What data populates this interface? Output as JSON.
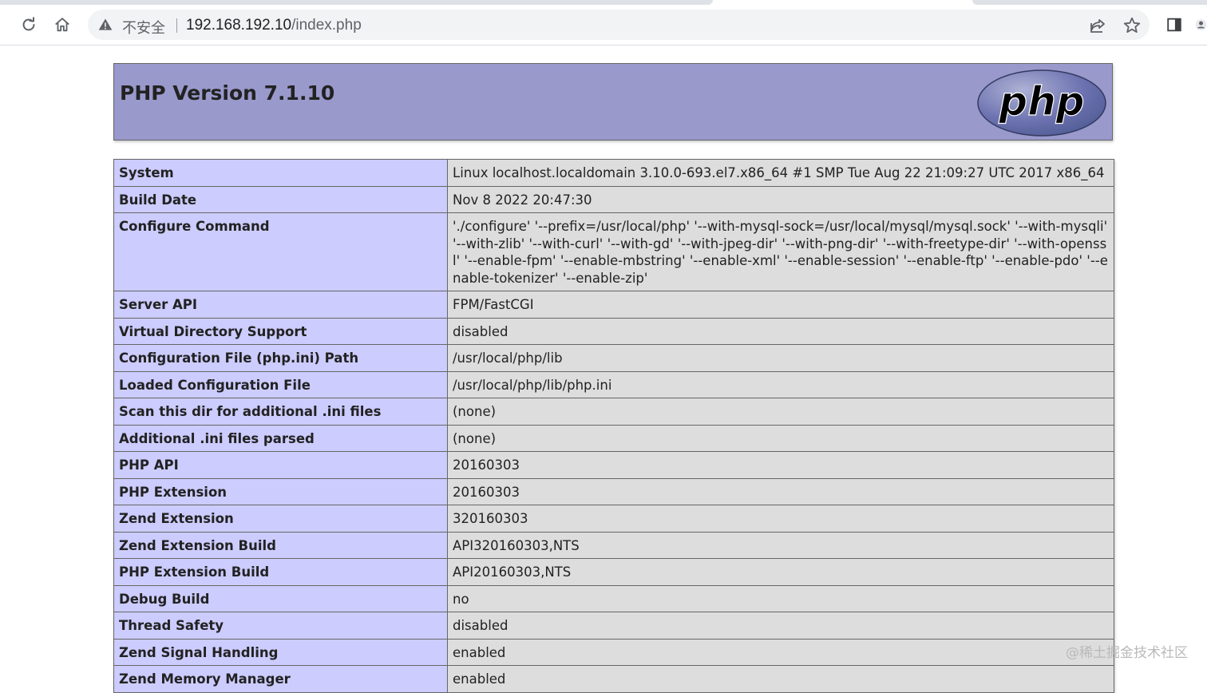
{
  "browser": {
    "security_label": "不安全",
    "url_host": "192.168.192.10",
    "url_path": "/index.php"
  },
  "icons": {
    "reload": "reload-icon",
    "home": "home-icon",
    "warning": "warning-icon",
    "share": "share-icon",
    "bookmark": "star-icon",
    "side_panel": "side-panel-icon",
    "profile": "profile-icon"
  },
  "phpinfo": {
    "title": "PHP Version 7.1.10",
    "logo_text": "php",
    "header_color": "#9999cc",
    "key_color": "#ccccff",
    "value_color": "#dddddd",
    "rows": [
      {
        "key": "System",
        "value": "Linux localhost.localdomain 3.10.0-693.el7.x86_64 #1 SMP Tue Aug 22 21:09:27 UTC 2017 x86_64"
      },
      {
        "key": "Build Date",
        "value": "Nov 8 2022 20:47:30"
      },
      {
        "key": "Configure Command",
        "value": "'./configure' '--prefix=/usr/local/php' '--with-mysql-sock=/usr/local/mysql/mysql.sock' '--with-mysqli' '--with-zlib' '--with-curl' '--with-gd' '--with-jpeg-dir' '--with-png-dir' '--with-freetype-dir' '--with-openssl' '--enable-fpm' '--enable-mbstring' '--enable-xml' '--enable-session' '--enable-ftp' '--enable-pdo' '--enable-tokenizer' '--enable-zip'"
      },
      {
        "key": "Server API",
        "value": "FPM/FastCGI"
      },
      {
        "key": "Virtual Directory Support",
        "value": "disabled"
      },
      {
        "key": "Configuration File (php.ini) Path",
        "value": "/usr/local/php/lib"
      },
      {
        "key": "Loaded Configuration File",
        "value": "/usr/local/php/lib/php.ini"
      },
      {
        "key": "Scan this dir for additional .ini files",
        "value": "(none)"
      },
      {
        "key": "Additional .ini files parsed",
        "value": "(none)"
      },
      {
        "key": "PHP API",
        "value": "20160303"
      },
      {
        "key": "PHP Extension",
        "value": "20160303"
      },
      {
        "key": "Zend Extension",
        "value": "320160303"
      },
      {
        "key": "Zend Extension Build",
        "value": "API320160303,NTS"
      },
      {
        "key": "PHP Extension Build",
        "value": "API20160303,NTS"
      },
      {
        "key": "Debug Build",
        "value": "no"
      },
      {
        "key": "Thread Safety",
        "value": "disabled"
      },
      {
        "key": "Zend Signal Handling",
        "value": "enabled"
      },
      {
        "key": "Zend Memory Manager",
        "value": "enabled"
      }
    ]
  },
  "watermark": "@稀土掘金技术社区"
}
